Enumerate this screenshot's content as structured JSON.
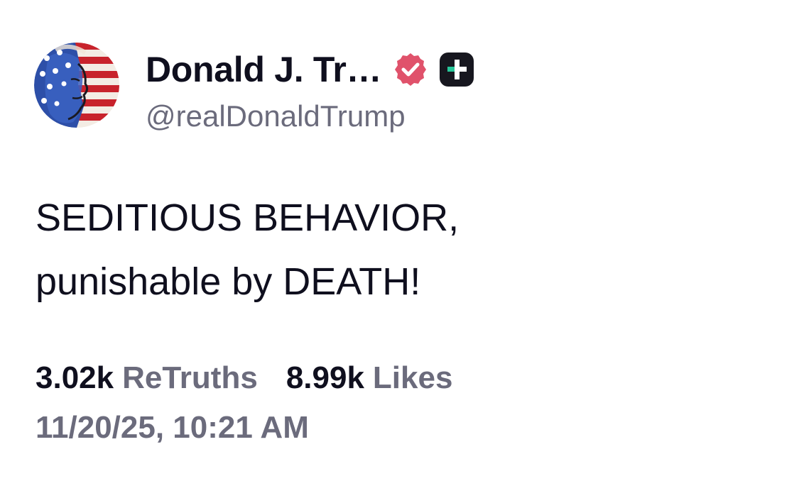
{
  "author": {
    "display_name": "Donald J. Tr…",
    "handle": "@realDonaldTrump",
    "verified_color": "#e0526b",
    "plus_badge_color": "#17171f",
    "plus_accent_color": "#27c79a"
  },
  "post": {
    "lines": [
      "SEDITIOUS BEHAVIOR,",
      "punishable by DEATH!"
    ]
  },
  "stats": {
    "retruths_count": "3.02k",
    "retruths_label": "ReTruths",
    "likes_count": "8.99k",
    "likes_label": "Likes"
  },
  "timestamp": "11/20/25, 10:21 AM",
  "icons": {
    "avatar": "profile-avatar",
    "verified": "verified-badge-icon",
    "plus": "truth-plus-icon"
  }
}
